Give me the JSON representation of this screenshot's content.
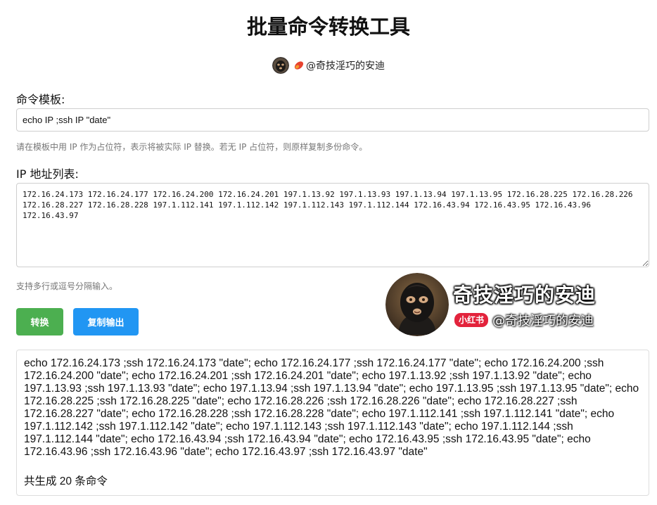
{
  "header": {
    "title": "批量命令转换工具",
    "author_name": "@奇技淫巧的安迪"
  },
  "template": {
    "label": "命令模板:",
    "value": "echo IP ;ssh IP \"date\"",
    "hint": "请在模板中用 IP 作为占位符，表示将被实际 IP 替换。若无 IP 占位符，则原样复制多份命令。"
  },
  "ip_list": {
    "label": "IP 地址列表:",
    "value": "172.16.24.173 172.16.24.177 172.16.24.200 172.16.24.201 197.1.13.92 197.1.13.93 197.1.13.94 197.1.13.95 172.16.28.225 172.16.28.226 172.16.28.227 172.16.28.228 197.1.112.141 197.1.112.142 197.1.112.143 197.1.112.144 172.16.43.94 172.16.43.95 172.16.43.96 172.16.43.97",
    "hint": "支持多行或逗号分隔输入。"
  },
  "buttons": {
    "convert": "转换",
    "copy": "复制输出"
  },
  "watermark": {
    "title": "奇技淫巧的安迪",
    "badge": "小红书",
    "handle": "@奇技淫巧的安迪"
  },
  "output": {
    "text": "echo 172.16.24.173 ;ssh 172.16.24.173 \"date\"; echo 172.16.24.177 ;ssh 172.16.24.177 \"date\"; echo 172.16.24.200 ;ssh 172.16.24.200 \"date\"; echo 172.16.24.201 ;ssh 172.16.24.201 \"date\"; echo 197.1.13.92 ;ssh 197.1.13.92 \"date\"; echo 197.1.13.93 ;ssh 197.1.13.93 \"date\"; echo 197.1.13.94 ;ssh 197.1.13.94 \"date\"; echo 197.1.13.95 ;ssh 197.1.13.95 \"date\"; echo 172.16.28.225 ;ssh 172.16.28.225 \"date\"; echo 172.16.28.226 ;ssh 172.16.28.226 \"date\"; echo 172.16.28.227 ;ssh 172.16.28.227 \"date\"; echo 172.16.28.228 ;ssh 172.16.28.228 \"date\"; echo 197.1.112.141 ;ssh 197.1.112.141 \"date\"; echo 197.1.112.142 ;ssh 197.1.112.142 \"date\"; echo 197.1.112.143 ;ssh 197.1.112.143 \"date\"; echo 197.1.112.144 ;ssh 197.1.112.144 \"date\"; echo 172.16.43.94 ;ssh 172.16.43.94 \"date\"; echo 172.16.43.95 ;ssh 172.16.43.95 \"date\"; echo 172.16.43.96 ;ssh 172.16.43.96 \"date\"; echo 172.16.43.97 ;ssh 172.16.43.97 \"date\"",
    "count": "共生成 20 条命令"
  },
  "colors": {
    "convert_button": "#4CAF50",
    "copy_button": "#2196F3",
    "badge": "#e3233c"
  },
  "icons": {
    "author_avatar": "avatar-icon",
    "author_badge": "red-book-logo-icon",
    "watermark_avatar": "watermark-avatar-icon"
  }
}
